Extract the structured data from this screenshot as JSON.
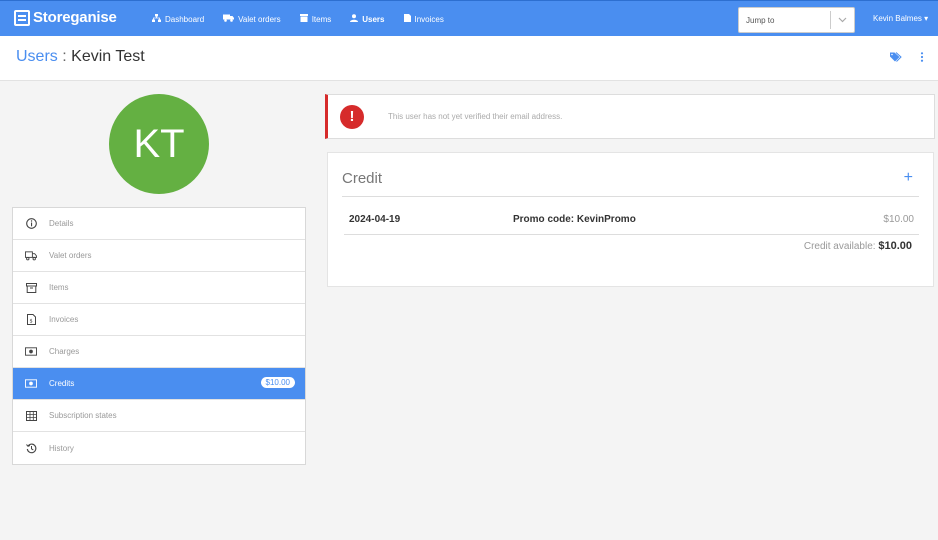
{
  "nav": {
    "brand": "Storeganise",
    "links": [
      {
        "label": "Dashboard",
        "icon": "sitemap-icon"
      },
      {
        "label": "Valet orders",
        "icon": "truck-icon"
      },
      {
        "label": "Items",
        "icon": "box-icon"
      },
      {
        "label": "Users",
        "icon": "user-icon"
      },
      {
        "label": "Invoices",
        "icon": "file-icon"
      }
    ],
    "jump_placeholder": "Jump to",
    "user_name": "Kevin Balmes"
  },
  "header": {
    "crumb": "Users",
    "separator": ":",
    "name": "Kevin Test"
  },
  "avatar": {
    "initials": "KT",
    "color": "#64b042"
  },
  "sidebar": {
    "items": [
      {
        "label": "Details",
        "icon": "info-icon"
      },
      {
        "label": "Valet orders",
        "icon": "truck-icon"
      },
      {
        "label": "Items",
        "icon": "archive-icon"
      },
      {
        "label": "Invoices",
        "icon": "invoice-icon"
      },
      {
        "label": "Charges",
        "icon": "money-icon"
      },
      {
        "label": "Credits",
        "icon": "money-icon",
        "badge": "$10.00"
      },
      {
        "label": "Subscription states",
        "icon": "table-icon"
      },
      {
        "label": "History",
        "icon": "history-icon"
      }
    ]
  },
  "alert": {
    "message": "This user has not yet verified their email address.",
    "color": "#d62b2b"
  },
  "credit": {
    "title": "Credit",
    "add_label": "+",
    "rows": [
      {
        "date": "2024-04-19",
        "description": "Promo code: KevinPromo",
        "amount": "$10.00"
      }
    ],
    "available_label": "Credit available:",
    "available_value": "$10.00"
  },
  "colors": {
    "accent": "#4a8ef0",
    "danger": "#d62b2b"
  }
}
